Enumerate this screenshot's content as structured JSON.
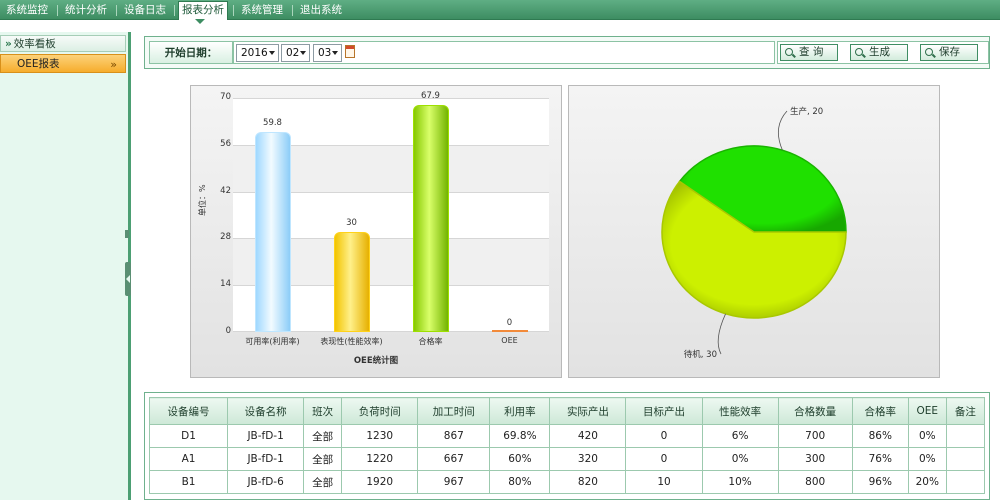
{
  "nav": {
    "items": [
      {
        "label": "系统监控"
      },
      {
        "label": "统计分析"
      },
      {
        "label": "设备日志"
      },
      {
        "label": "报表分析",
        "active": true
      },
      {
        "label": "系统管理"
      },
      {
        "label": "退出系统"
      }
    ]
  },
  "sidebar": {
    "group_label": "效率看板",
    "group_icon": "double-chevron-right-icon",
    "item_label": "OEE报表",
    "item_icon": "double-chevron-right-icon"
  },
  "filter": {
    "label": "开始日期：",
    "year": "2016",
    "month": "02",
    "day": "03",
    "calendar_icon": "calendar-icon",
    "buttons": {
      "query": "查 询",
      "generate": "生成",
      "save": "保存"
    },
    "button_icon": "search-icon"
  },
  "chart_data": [
    {
      "type": "bar",
      "categories": [
        "可用率(利用率)",
        "表现性(性能效率)",
        "合格率",
        "OEE"
      ],
      "values": [
        59.8,
        30,
        67.9,
        0
      ],
      "data_labels": [
        "59.8",
        "30",
        "67.9",
        "0"
      ],
      "yticks": [
        0,
        14,
        28,
        42,
        56,
        70
      ],
      "ylim": [
        0,
        70
      ],
      "ylabel": "单位：%",
      "xlabel": "OEE统计图",
      "colors": [
        "#bfe6ff",
        "#ffd21a",
        "#9ee000",
        "#f28a3a"
      ]
    },
    {
      "type": "pie",
      "labels": [
        "生产",
        "待机"
      ],
      "values": [
        20,
        30
      ],
      "slice_labels": [
        "生产, 20",
        "待机, 30"
      ],
      "colors": [
        "#1fe000",
        "#ccf000"
      ]
    }
  ],
  "table": {
    "headers": [
      "设备编号",
      "设备名称",
      "班次",
      "负荷时间",
      "加工时间",
      "利用率",
      "实际产出",
      "目标产出",
      "性能效率",
      "合格数量",
      "合格率",
      "OEE",
      "备注"
    ],
    "rows": [
      [
        "D1",
        "JB-fD-1",
        "全部",
        "1230",
        "867",
        "69.8%",
        "420",
        "0",
        "6%",
        "700",
        "86%",
        "0%",
        ""
      ],
      [
        "A1",
        "JB-fD-1",
        "全部",
        "1220",
        "667",
        "60%",
        "320",
        "0",
        "0%",
        "300",
        "76%",
        "0%",
        ""
      ],
      [
        "B1",
        "JB-fD-6",
        "全部",
        "1920",
        "967",
        "80%",
        "820",
        "10",
        "10%",
        "800",
        "96%",
        "20%",
        ""
      ]
    ]
  }
}
